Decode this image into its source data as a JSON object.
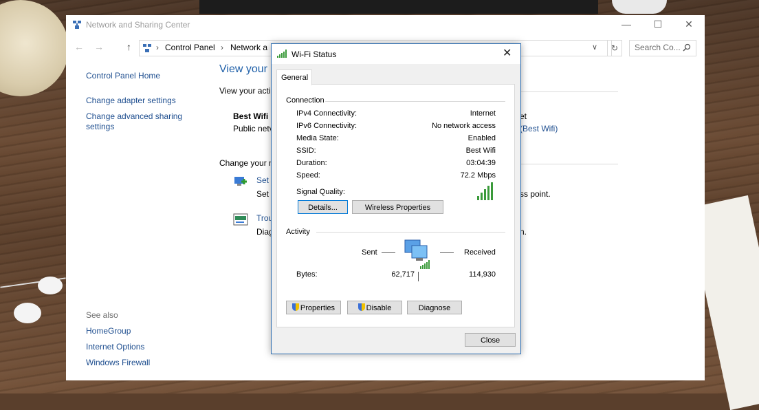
{
  "explorer": {
    "title": "Network and Sharing Center",
    "breadcrumbs": [
      "Control Panel",
      "Network a"
    ],
    "search_placeholder": "Search Co...",
    "sidebar": {
      "home": "Control Panel Home",
      "items": [
        "Change adapter settings",
        "Change advanced sharing settings"
      ],
      "see_also_heading": "See also",
      "see_also": [
        "HomeGroup",
        "Internet Options",
        "Windows Firewall"
      ]
    },
    "main": {
      "heading": "View your",
      "subheading": "View your acti",
      "network_name": "Best Wifi",
      "network_type": "Public netv",
      "access_suffix": "et",
      "connection_link": "(Best Wifi)",
      "change_heading": "Change your n",
      "task1_link": "Set",
      "task1_desc": "Set",
      "task1_suffix": "ss point.",
      "task2_link": "Trou",
      "task2_desc": "Diag",
      "task2_suffix": "n."
    }
  },
  "dialog": {
    "title": "Wi-Fi Status",
    "tab": "General",
    "connection_group": "Connection",
    "rows": [
      {
        "label": "IPv4 Connectivity:",
        "value": "Internet"
      },
      {
        "label": "IPv6 Connectivity:",
        "value": "No network access"
      },
      {
        "label": "Media State:",
        "value": "Enabled"
      },
      {
        "label": "SSID:",
        "value": "Best Wifi"
      },
      {
        "label": "Duration:",
        "value": "03:04:39"
      },
      {
        "label": "Speed:",
        "value": "72.2 Mbps"
      }
    ],
    "signal_label": "Signal Quality:",
    "signal_bars": 5,
    "details_button": "Details...",
    "wireless_button": "Wireless Properties",
    "activity_group": "Activity",
    "sent_label": "Sent",
    "received_label": "Received",
    "bytes_label": "Bytes:",
    "bytes_sent": "62,717",
    "bytes_received": "114,930",
    "properties_button": "Properties",
    "disable_button": "Disable",
    "diagnose_button": "Diagnose",
    "close_button": "Close"
  },
  "colors": {
    "link": "#1e4e8f",
    "highlight": "#ffeb00",
    "signal": "#3a9a3a",
    "dialog_border": "#2b6cb0"
  }
}
